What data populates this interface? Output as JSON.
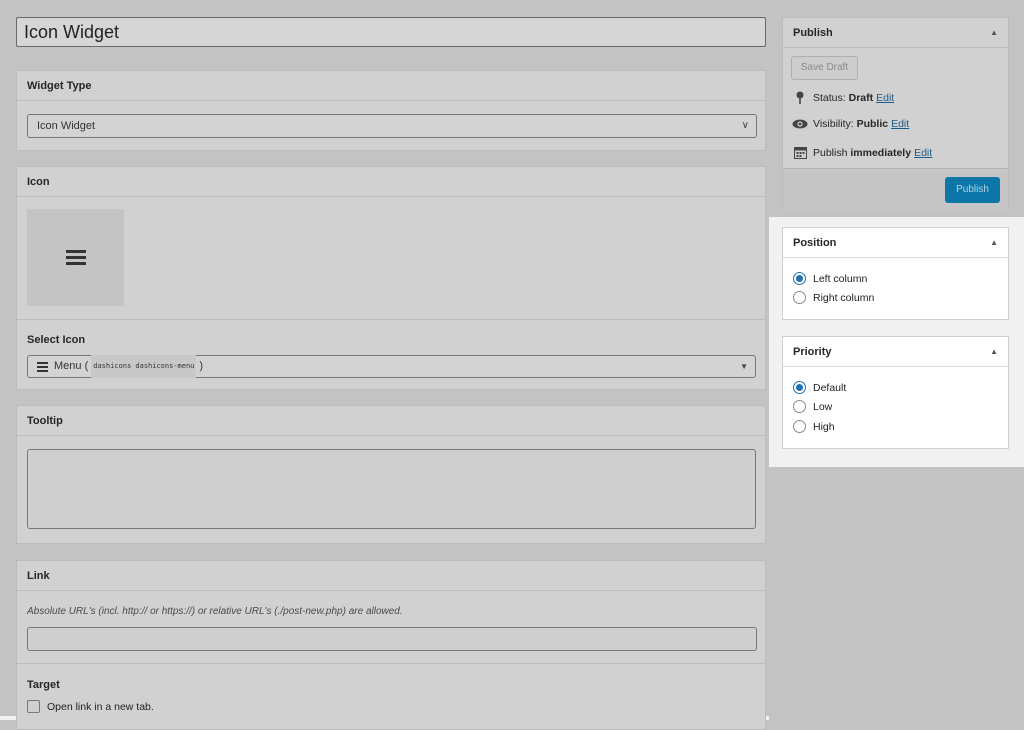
{
  "post": {
    "title": "Icon Widget"
  },
  "widget_type": {
    "heading": "Widget Type",
    "selected": "Icon Widget"
  },
  "icon": {
    "heading": "Icon",
    "select_label": "Select Icon",
    "selected_name": "Menu (",
    "selected_classes": "dashicons dashicons-menu",
    "selected_close": ")"
  },
  "tooltip": {
    "heading": "Tooltip",
    "value": ""
  },
  "link": {
    "heading": "Link",
    "hint": "Absolute URL's (incl. http:// or https://) or relative URL's (./post-new.php) are allowed.",
    "value": "",
    "target_label": "Target",
    "target_checkbox_label": "Open link in a new tab.",
    "target_checked": false
  },
  "publish": {
    "heading": "Publish",
    "save_draft": "Save Draft",
    "status_label": "Status:",
    "status_value": "Draft",
    "visibility_label": "Visibility:",
    "visibility_value": "Public",
    "publish_label": "Publish",
    "publish_value": "immediately",
    "edit_label": "Edit",
    "publish_button": "Publish"
  },
  "position": {
    "heading": "Position",
    "options": [
      "Left column",
      "Right column"
    ],
    "selected": "Left column"
  },
  "priority": {
    "heading": "Priority",
    "options": [
      "Default",
      "Low",
      "High"
    ],
    "selected": "Default"
  },
  "colors": {
    "accent": "#2271b1",
    "publish_button": "#0c77a8",
    "link": "#1a5b8a"
  }
}
